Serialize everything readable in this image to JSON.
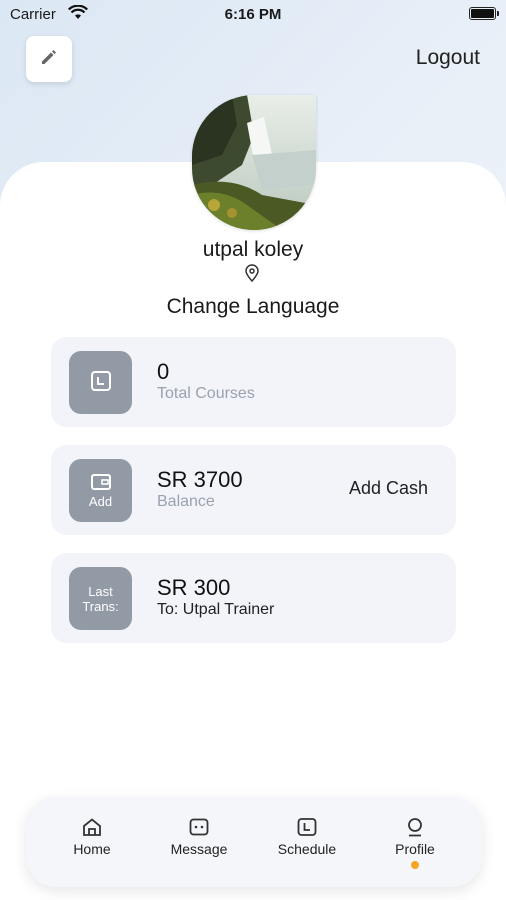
{
  "status": {
    "carrier": "Carrier",
    "time": "6:16 PM"
  },
  "header": {
    "logout_label": "Logout"
  },
  "profile": {
    "name": "utpal koley",
    "change_language": "Change Language"
  },
  "cards": {
    "courses": {
      "value": "0",
      "label": "Total Courses"
    },
    "balance": {
      "tile_label": "Add",
      "value": "SR 3700",
      "label": "Balance",
      "action": "Add Cash"
    },
    "last_trans": {
      "tile_label": "Last Trans:",
      "value": "SR 300",
      "label": "To: Utpal Trainer"
    }
  },
  "tabs": [
    {
      "label": "Home",
      "icon": "home-icon"
    },
    {
      "label": "Message",
      "icon": "message-icon"
    },
    {
      "label": "Schedule",
      "icon": "schedule-icon"
    },
    {
      "label": "Profile",
      "icon": "profile-icon",
      "active": true
    }
  ],
  "colors": {
    "accent_dot": "#f5a623",
    "tile": "#929aa6",
    "card_bg": "#f2f4f9"
  }
}
